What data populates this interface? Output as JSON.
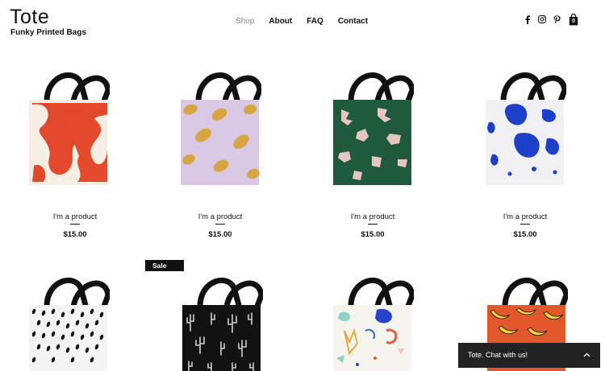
{
  "brand": {
    "title": "Tote",
    "tagline": "Funky Printed Bags"
  },
  "nav": {
    "items": [
      {
        "label": "Shop",
        "active": true
      },
      {
        "label": "About"
      },
      {
        "label": "FAQ"
      },
      {
        "label": "Contact"
      }
    ]
  },
  "social": {
    "icons": [
      "facebook-icon",
      "instagram-icon",
      "pinterest-icon"
    ]
  },
  "cart": {
    "count": "0"
  },
  "products": [
    {
      "name": "I'm a product",
      "price": "$15.00",
      "pattern": "orange-swirls"
    },
    {
      "name": "I'm a product",
      "price": "$15.00",
      "pattern": "lemons"
    },
    {
      "name": "I'm a product",
      "price": "$15.00",
      "pattern": "green-hands"
    },
    {
      "name": "I'm a product",
      "price": "$15.00",
      "pattern": "blue-blobs"
    },
    {
      "pattern": "black-dots"
    },
    {
      "pattern": "cactus",
      "badge": "Sale"
    },
    {
      "pattern": "abstract-shapes"
    },
    {
      "pattern": "bananas"
    }
  ],
  "chat": {
    "label": "Tote. Chat with us!"
  },
  "colors": {
    "accent": "#111111",
    "muted": "#8a8a8a",
    "chat_bg": "#232323"
  }
}
